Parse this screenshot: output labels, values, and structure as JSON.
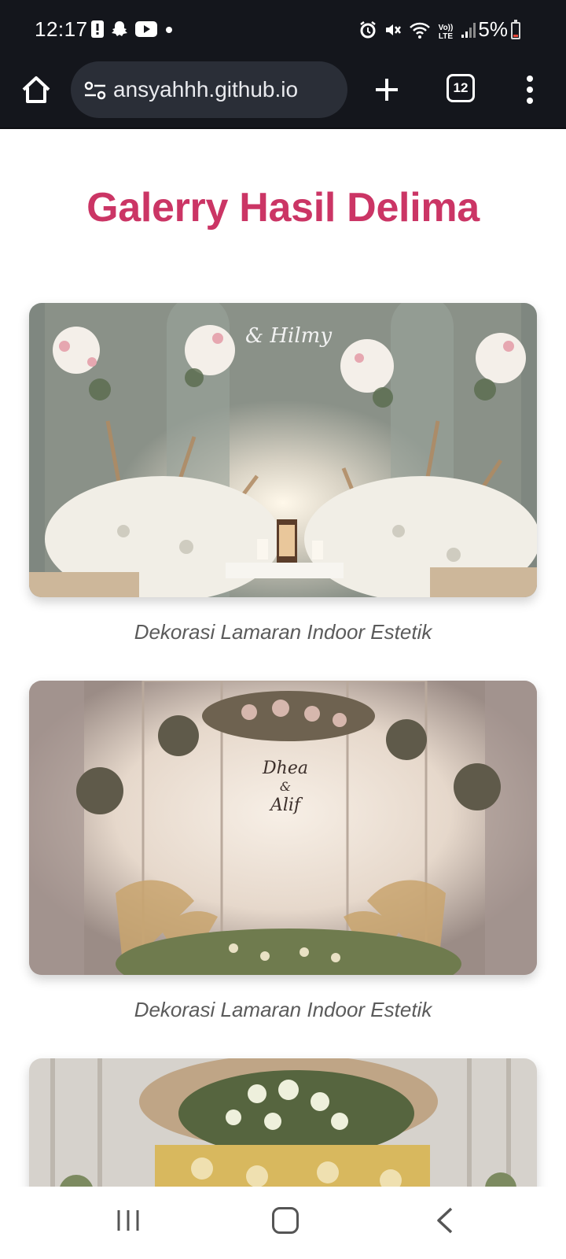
{
  "status_bar": {
    "time": "12:17",
    "battery": "5%",
    "left_icons": [
      "alert-icon",
      "snapchat-icon",
      "youtube-icon",
      "dot-icon"
    ],
    "right_icons": [
      "alarm-icon",
      "mute-icon",
      "wifi-icon",
      "volte-icon",
      "signal-icon"
    ],
    "network_label": "Vo)) LTE"
  },
  "browser": {
    "url": "ansyahhh.github.io",
    "tab_count": "12",
    "icons": [
      "home-icon",
      "site-settings-icon",
      "plus-icon",
      "tabs-icon",
      "more-vert-icon"
    ]
  },
  "page": {
    "title": "Galerry Hasil Delima",
    "gallery": [
      {
        "caption": "Dekorasi Lamaran Indoor Estetik",
        "photo_text": "& Hilmy"
      },
      {
        "caption": "Dekorasi Lamaran Indoor Estetik",
        "photo_text_1": "Dhea",
        "photo_text_2": "&",
        "photo_text_3": "Alif"
      },
      {
        "caption": ""
      }
    ]
  },
  "nav_bar": {
    "icons": [
      "recent-apps-icon",
      "home-nav-icon",
      "back-icon"
    ]
  },
  "colors": {
    "title": "#cb3565",
    "caption": "#5b5b5b",
    "system_bar": "#14161c",
    "url_pill": "#2a2e37"
  }
}
